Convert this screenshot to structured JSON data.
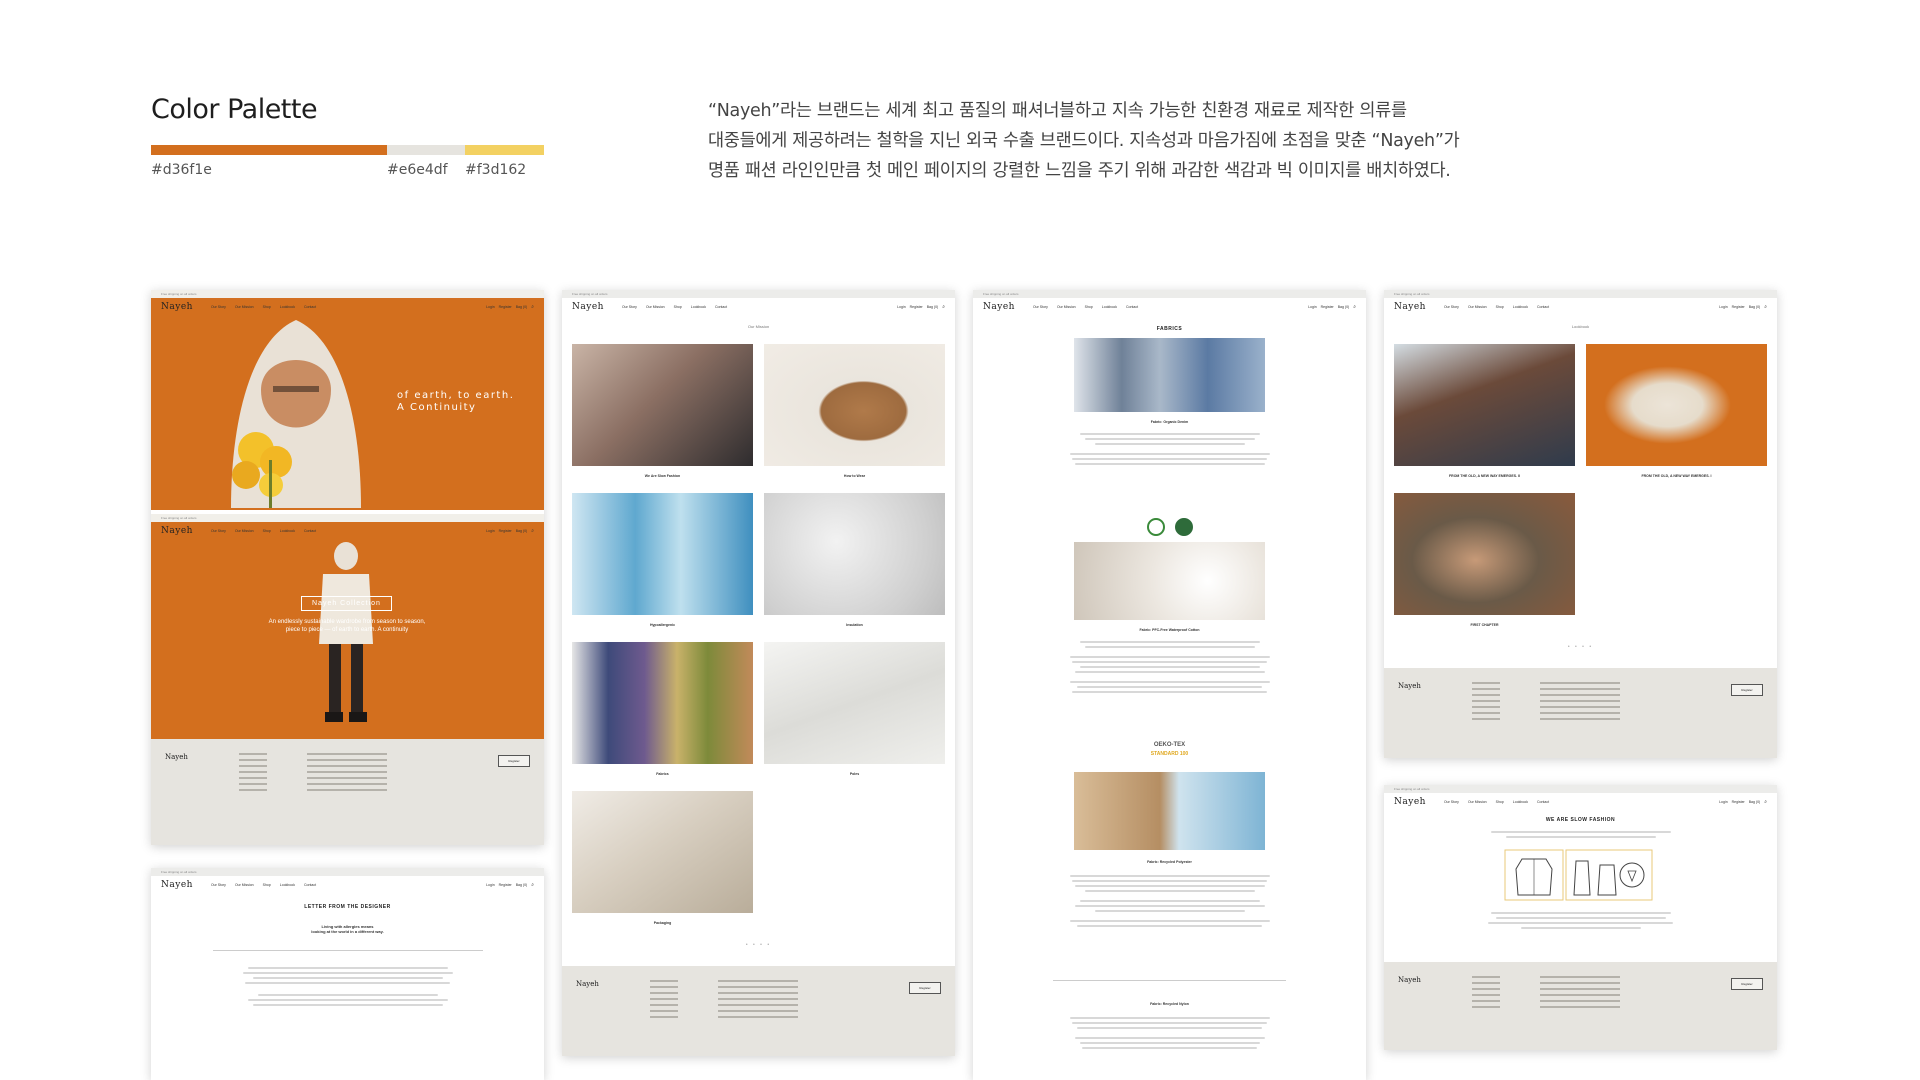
{
  "header": {
    "title": "Color Palette",
    "colors": [
      {
        "hex": "#d36f1e",
        "label": "#d36f1e"
      },
      {
        "hex": "#e6e4df",
        "label": "#e6e4df"
      },
      {
        "hex": "#f3d162",
        "label": "#f3d162"
      }
    ],
    "description": [
      "“Nayeh”라는 브랜드는 세계 최고 품질의 패셔너블하고 지속 가능한 친환경 재료로 제작한 의류를",
      "대중들에게 제공하려는 철학을 지닌 외국 수출 브랜드이다. 지속성과 마음가짐에 초점을 맞춘 “Nayeh”가",
      "명품 패션 라인인만큼 첫 메인 페이지의 강렬한 느낌을 주기 위해 과감한 색감과 빅 이미지를 배치하였다."
    ]
  },
  "site": {
    "logo": "Nayeh",
    "topstrip": "Free shipping on all orders",
    "nav": [
      "Our Story",
      "Our Mission",
      "Shop",
      "Lookbook",
      "Contact"
    ],
    "nav_right": [
      "Login",
      "Register",
      "Bag (0)"
    ],
    "footer_register": "Register"
  },
  "mock_home": {
    "tagline_1": "of earth, to earth.",
    "tagline_2": "A Continuity",
    "collection": "Nayeh Collection",
    "collection_sub": "An endlessly sustainable wardrobe from season to season, piece to piece — of earth to earth. A continuity"
  },
  "mock_mission": {
    "title": "Our Mission",
    "captions": [
      "We Are Slow Fashion",
      "How to Wear",
      "Hypoallergenic",
      "Insulation",
      "Fabrics",
      "Poles",
      "Packaging"
    ]
  },
  "mock_fabrics": {
    "title": "FABRICS",
    "sections": [
      "Fabric: Organic Denim",
      "Fabric: PFC-Free Waterproof Cotton",
      "Fabric: Recycled Polyester",
      "Fabric: Recycled Nylon"
    ],
    "oeko": "OEKO-TEX",
    "oeko_std": "STANDARD 100"
  },
  "mock_lookbook": {
    "title": "Lookbook",
    "captions": [
      "FROM THE OLD, A NEW WAY EMERGES. II",
      "FROM THE OLD, A NEW WAY EMERGES. I",
      "FIRST CHAPTER"
    ]
  },
  "mock_letter": {
    "title": "LETTER FROM THE DESIGNER",
    "sub_1": "Living with allergies means",
    "sub_2": "looking at the world in a different way."
  },
  "mock_slow": {
    "title": "WE ARE SLOW FASHION"
  }
}
